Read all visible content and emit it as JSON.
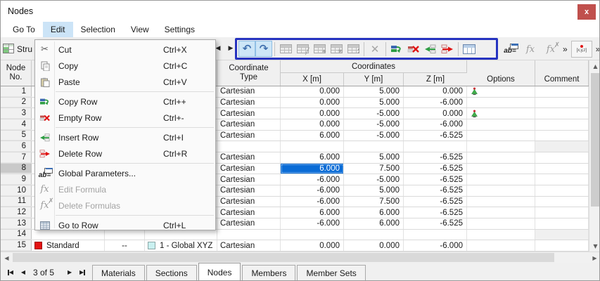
{
  "colors": {
    "selection_blue": "#0a6cd6",
    "toolbar_focus_border": "#2633c0",
    "close_button_red": "#c0504d",
    "menu_highlight": "#cce4f7",
    "node_type_swatch": "#e31313",
    "coordinate_system_swatch": "#c9f0f0",
    "support_icon_green": "#3fae49",
    "support_icon_red": "#cc2a36"
  },
  "window": {
    "title": "Nodes",
    "close_glyph": "x"
  },
  "menubar": {
    "items": [
      "Go To",
      "Edit",
      "Selection",
      "View",
      "Settings"
    ],
    "active_item": "Edit"
  },
  "toolbar": {
    "structure_button_label": "Stru",
    "ab_label": "ab=",
    "fx_label": "fx",
    "fx_delete_label": "fx",
    "xyz_label": "[x,y,z]",
    "overflow_glyph_1": "»",
    "overflow_glyph_2": "»"
  },
  "edit_menu": {
    "items": [
      {
        "label": "Cut",
        "shortcut": "Ctrl+X",
        "disabled": false
      },
      {
        "label": "Copy",
        "shortcut": "Ctrl+C",
        "disabled": false
      },
      {
        "label": "Paste",
        "shortcut": "Ctrl+V",
        "disabled": false
      },
      {
        "label": "Copy Row",
        "shortcut": "Ctrl++",
        "disabled": false
      },
      {
        "label": "Empty Row",
        "shortcut": "Ctrl+-",
        "disabled": false
      },
      {
        "label": "Insert Row",
        "shortcut": "Ctrl+I",
        "disabled": false
      },
      {
        "label": "Delete Row",
        "shortcut": "Ctrl+R",
        "disabled": false
      },
      {
        "label": "Global Parameters...",
        "shortcut": "",
        "disabled": false
      },
      {
        "label": "Edit Formula",
        "shortcut": "",
        "disabled": true
      },
      {
        "label": "Delete Formulas",
        "shortcut": "",
        "disabled": true
      },
      {
        "label": "Go to Row",
        "shortcut": "Ctrl+L",
        "disabled": false
      }
    ]
  },
  "table": {
    "header": {
      "node_no_line1": "Node",
      "node_no_line2": "No.",
      "coordinate_line1": "Coordinate",
      "coordinate_line2": "Type",
      "coordinates_group": "Coordinates",
      "x": "X [m]",
      "y": "Y [m]",
      "z": "Z [m]",
      "options": "Options",
      "comment": "Comment"
    },
    "rows": [
      {
        "no": "1",
        "coordinate_type": "Cartesian",
        "x": "0.000",
        "y": "5.000",
        "z": "0.000",
        "support": true
      },
      {
        "no": "2",
        "coordinate_type": "Cartesian",
        "x": "0.000",
        "y": "5.000",
        "z": "-6.000"
      },
      {
        "no": "3",
        "coordinate_type": "Cartesian",
        "x": "0.000",
        "y": "-5.000",
        "z": "0.000",
        "support": true
      },
      {
        "no": "4",
        "coordinate_type": "Cartesian",
        "x": "0.000",
        "y": "-5.000",
        "z": "-6.000"
      },
      {
        "no": "5",
        "coordinate_type": "Cartesian",
        "x": "6.000",
        "y": "-5.000",
        "z": "-6.525"
      },
      {
        "no": "6",
        "empty": true
      },
      {
        "no": "7",
        "coordinate_type": "Cartesian",
        "x": "6.000",
        "y": "5.000",
        "z": "-6.525"
      },
      {
        "no": "8",
        "coordinate_type": "Cartesian",
        "x": "6.000",
        "y": "7.500",
        "z": "-6.525",
        "selected_cell": "x"
      },
      {
        "no": "9",
        "coordinate_type": "Cartesian",
        "x": "-6.000",
        "y": "-5.000",
        "z": "-6.525"
      },
      {
        "no": "10",
        "coordinate_type": "Cartesian",
        "x": "-6.000",
        "y": "5.000",
        "z": "-6.525"
      },
      {
        "no": "11",
        "coordinate_type": "Cartesian",
        "x": "-6.000",
        "y": "7.500",
        "z": "-6.525"
      },
      {
        "no": "12",
        "coordinate_type": "Cartesian",
        "x": "6.000",
        "y": "6.000",
        "z": "-6.525"
      },
      {
        "no": "13",
        "coordinate_type": "Cartesian",
        "x": "-6.000",
        "y": "6.000",
        "z": "-6.525"
      },
      {
        "no": "14",
        "empty": true
      },
      {
        "no": "15",
        "node_type": "Standard",
        "reference": "--",
        "coordinate_system": "1 - Global XYZ",
        "coordinate_type": "Cartesian",
        "x": "0.000",
        "y": "0.000",
        "z": "-6.000"
      }
    ]
  },
  "statusbar": {
    "page_indicator": "3 of 5",
    "tabs": [
      "Materials",
      "Sections",
      "Nodes",
      "Members",
      "Member Sets"
    ],
    "active_tab": "Nodes"
  }
}
